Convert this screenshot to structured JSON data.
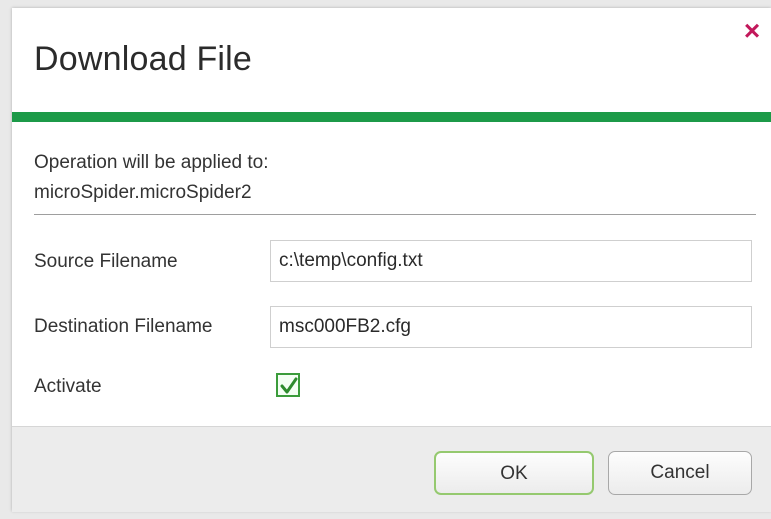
{
  "dialog": {
    "title": "Download File",
    "close_icon": "close-icon",
    "accent_color": "#1c9a48",
    "close_color": "#c2185b"
  },
  "operation": {
    "line1": "Operation will be applied to:",
    "line2": "microSpider.microSpider2"
  },
  "form": {
    "source_label": "Source Filename",
    "source_value": "c:\\temp\\config.txt",
    "destination_label": "Destination Filename",
    "destination_value": "msc000FB2.cfg",
    "activate_label": "Activate",
    "activate_checked": true
  },
  "buttons": {
    "ok_label": "OK",
    "cancel_label": "Cancel"
  }
}
